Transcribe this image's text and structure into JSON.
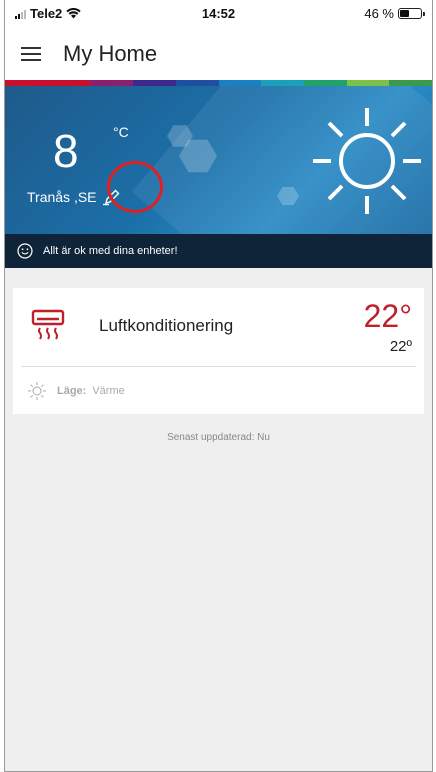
{
  "statusbar": {
    "carrier": "Tele2",
    "time": "14:52",
    "battery_text": "46 %",
    "battery_level": 0.46
  },
  "appbar": {
    "title": "My Home",
    "menu_icon": "hamburger-menu-icon"
  },
  "colors": {
    "accent_red": "#c0202a",
    "hero_blue": "#1b6fa8",
    "status_strip": "#0f2438",
    "highlight_circle": "#e02020",
    "rainbow": [
      "#c8102e",
      "#c8102e",
      "#8a1f6b",
      "#3b2a8c",
      "#1f4fa0",
      "#1b7fc4",
      "#1aa0b8",
      "#1fa36a",
      "#7cc04a",
      "#3a9a4a"
    ]
  },
  "weather": {
    "temperature": "8",
    "unit": "°C",
    "location": "Tranås ,SE",
    "edit_icon": "pencil-icon",
    "condition_icon": "sun-icon"
  },
  "status": {
    "icon": "smiley-icon",
    "message": "Allt är ok med dina enheter!"
  },
  "devices": [
    {
      "icon": "air-conditioner-icon",
      "name": "Luftkonditionering",
      "set_temperature": "22°",
      "current_temperature": "22º",
      "mode_icon": "sun-outline-icon",
      "mode_label": "Läge:",
      "mode_value": "Värme"
    }
  ],
  "footer": {
    "updated": "Senast uppdaterad: Nu"
  }
}
